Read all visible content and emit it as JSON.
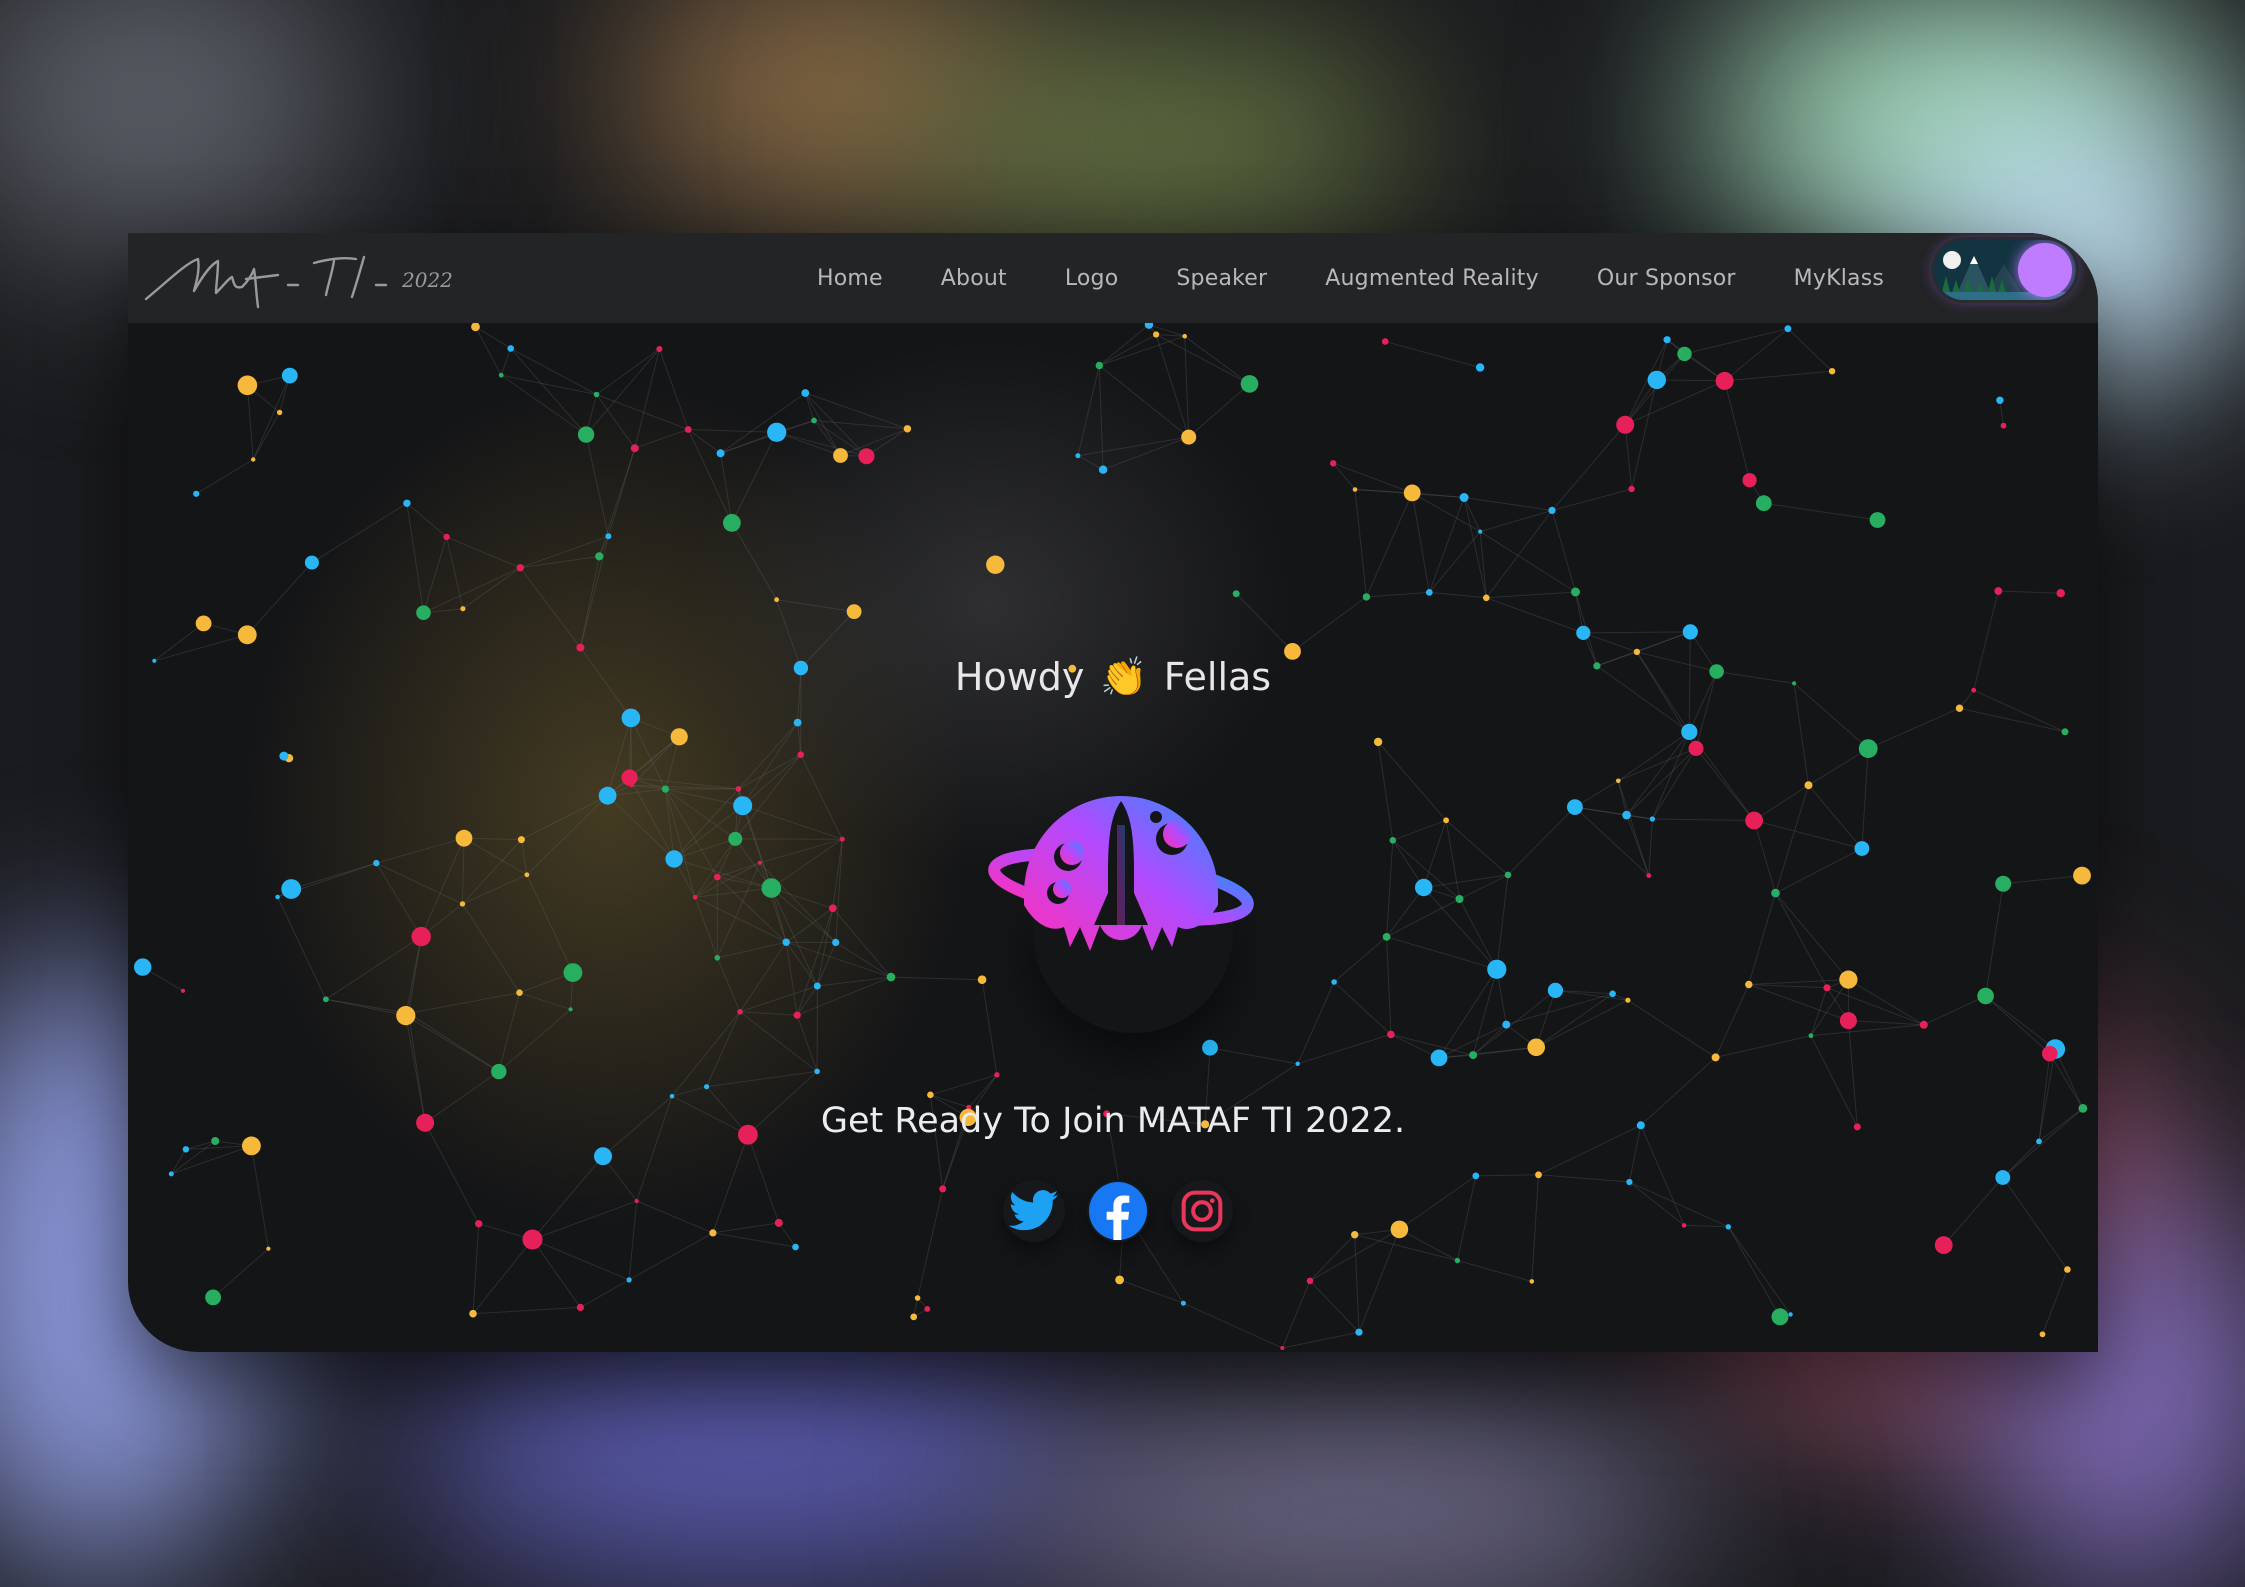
{
  "site": {
    "brand_signature": "Mataf - TI - 2022"
  },
  "nav": {
    "items": [
      {
        "label": "Home"
      },
      {
        "label": "About"
      },
      {
        "label": "Logo"
      },
      {
        "label": "Speaker"
      },
      {
        "label": "Augmented Reality"
      },
      {
        "label": "Our Sponsor"
      },
      {
        "label": "MyKlass"
      }
    ],
    "theme_toggle_icon": "night-landscape-toggle-icon"
  },
  "hero": {
    "greeting_before": "Howdy",
    "greeting_emoji": "👏",
    "greeting_after": "Fellas",
    "logo_icon": "rocket-planet-logo-icon",
    "tagline": "Get Ready To Join MATAF TI 2022."
  },
  "socials": [
    {
      "name": "twitter-icon",
      "color": "#1da1f2"
    },
    {
      "name": "facebook-icon",
      "color": "#1877f2"
    },
    {
      "name": "instagram-icon",
      "color": "#e1306c"
    }
  ],
  "colors": {
    "accent_purple": "#b27aff",
    "particle_blue": "#29b6f6",
    "particle_green": "#27ae60",
    "particle_yellow": "#f6b93b",
    "particle_red": "#e8205a",
    "logo_gradient_start": "#ff2fb8",
    "logo_gradient_end": "#2f8cff"
  }
}
